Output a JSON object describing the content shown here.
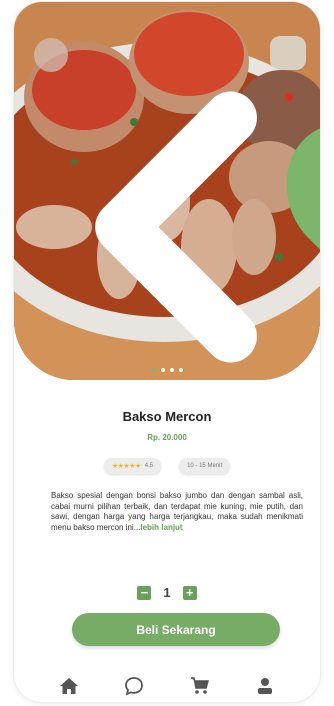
{
  "product": {
    "name": "Bakso Mercon",
    "price": "Rp. 20.000",
    "rating": "4.5",
    "rating_stars": "★★★★★",
    "prep_time": "10 - 15 Menit",
    "description": "Bakso spesial dengan bonsi bakso jumbo dan dengan sambal asli, cabai murni pilihan terbaik, dan terdapat mie kuning, mie putih, dan sawi, dengan harga yang harga terjangkau, maka sudah menikmati menu bakso mercon ini...",
    "read_more": "lebih lanjut"
  },
  "carousel": {
    "count": 4,
    "active": 0
  },
  "quantity": {
    "value": "1",
    "minus": "−",
    "plus": "+"
  },
  "buy_button": {
    "label": "Beli Sekarang"
  },
  "colors": {
    "accent": "#76ac65",
    "star": "#f0b329"
  },
  "icons": {
    "back": "chevron-left-icon",
    "favorite": "heart-icon",
    "nav": [
      "home-icon",
      "chat-icon",
      "cart-icon",
      "profile-icon"
    ]
  }
}
